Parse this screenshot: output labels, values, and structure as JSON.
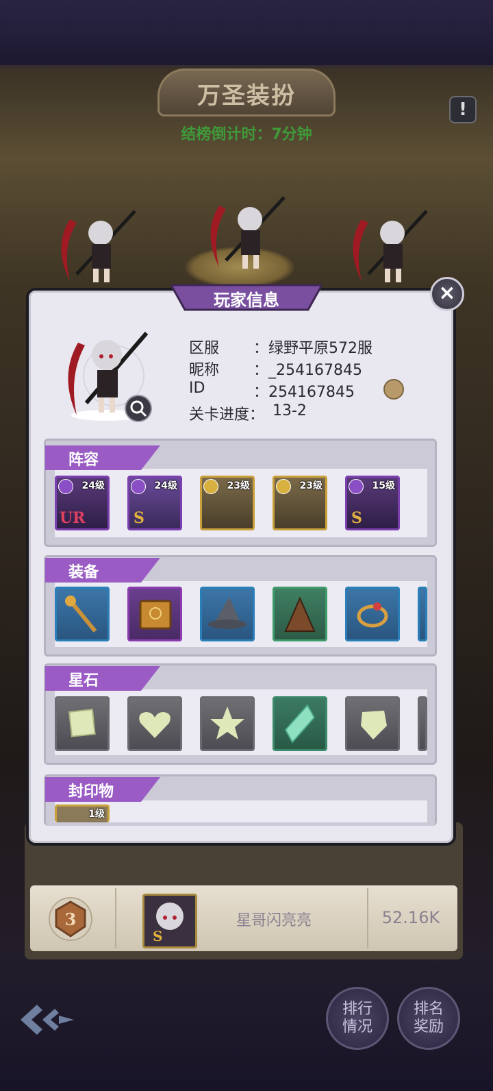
{
  "event": {
    "title": "万圣装扮",
    "countdown": "结榜倒计时：7分钟",
    "info_icon": "!"
  },
  "dialog": {
    "title": "玩家信息",
    "close_icon": "×",
    "fields": [
      {
        "label": "区服",
        "value": "：绿野平原572服"
      },
      {
        "label": "昵称",
        "value": "：_254167845"
      },
      {
        "label": "ID",
        "value": "：254167845"
      },
      {
        "label": "关卡进度：",
        "value": "13-2"
      }
    ]
  },
  "lineup": {
    "title": "阵容",
    "heroes": [
      {
        "level": "24级",
        "grade": "UR",
        "frame": "#7b3fb0"
      },
      {
        "level": "24级",
        "grade": "S",
        "frame": "#7b3fb0"
      },
      {
        "level": "23级",
        "grade": "",
        "frame": "#c9a03a"
      },
      {
        "level": "23级",
        "grade": "",
        "frame": "#c9a03a"
      },
      {
        "level": "15级",
        "grade": "S",
        "frame": "#7b3fb0"
      }
    ]
  },
  "equipment": {
    "title": "装备",
    "items": [
      "staff-icon",
      "book-icon",
      "hat-icon",
      "cloak-icon",
      "ring-icon"
    ]
  },
  "starstones": {
    "title": "星石",
    "items": [
      "square-gem-icon",
      "heart-gem-icon",
      "star-gem-icon",
      "crystal-gem-icon",
      "round-gem-icon"
    ]
  },
  "seals": {
    "title": "封印物",
    "first_level": "1级"
  },
  "ranking": {
    "rank": "3",
    "name": "星哥闪亮亮",
    "score": "52.16K",
    "avatar_grade": "S"
  },
  "buttons": {
    "rank_status": "排行\n情况",
    "rank_reward": "排名\n奖励"
  },
  "colors": {
    "accent_purple": "#9a5cc4",
    "countdown_green": "#3f9a3a"
  }
}
